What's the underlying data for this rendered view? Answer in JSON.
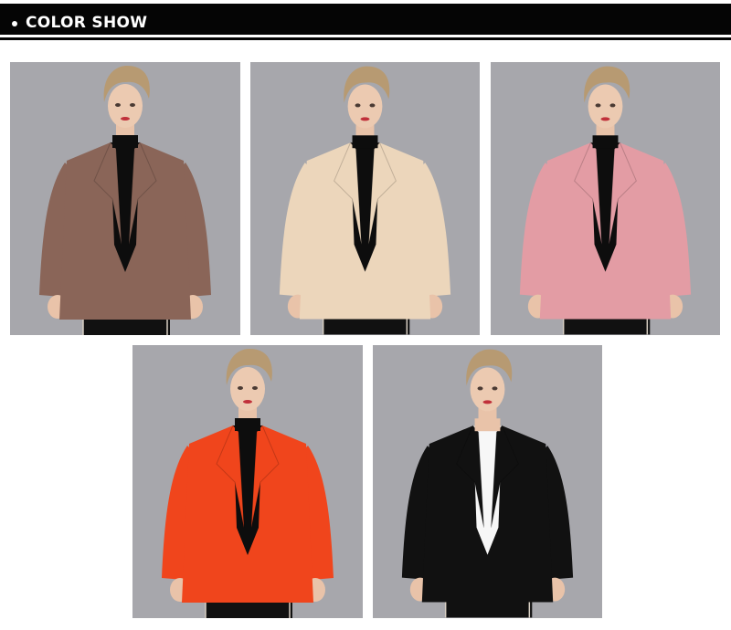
{
  "header": {
    "title": "COLOR SHOW"
  },
  "photos": [
    {
      "color_name": "brown",
      "jacket_color": "#8a6558",
      "inner_color": "#0d0d0d"
    },
    {
      "color_name": "beige",
      "jacket_color": "#ecd6bb",
      "inner_color": "#0d0d0d"
    },
    {
      "color_name": "pink",
      "jacket_color": "#e39ca4",
      "inner_color": "#0d0d0d"
    },
    {
      "color_name": "orange",
      "jacket_color": "#f0451c",
      "inner_color": "#0d0d0d"
    },
    {
      "color_name": "black",
      "jacket_color": "#111111",
      "inner_color": "#f7f7f7"
    }
  ]
}
